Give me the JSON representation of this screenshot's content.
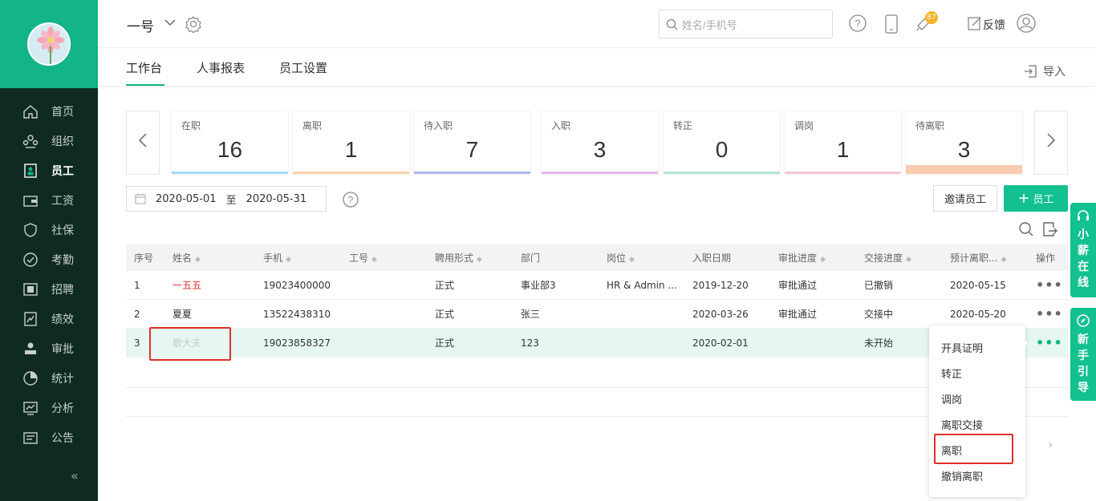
{
  "header": {
    "company": "一号",
    "search_placeholder": "姓名/手机号",
    "notification_count": "87",
    "feedback_label": "反馈"
  },
  "sidebar": {
    "items": [
      {
        "label": "首页",
        "icon": "home-icon"
      },
      {
        "label": "组织",
        "icon": "org-icon"
      },
      {
        "label": "员工",
        "icon": "employee-icon",
        "active": true
      },
      {
        "label": "工资",
        "icon": "wallet-icon"
      },
      {
        "label": "社保",
        "icon": "shield-icon"
      },
      {
        "label": "考勤",
        "icon": "attendance-icon"
      },
      {
        "label": "招聘",
        "icon": "recruit-icon"
      },
      {
        "label": "绩效",
        "icon": "performance-icon"
      },
      {
        "label": "审批",
        "icon": "approval-icon"
      },
      {
        "label": "统计",
        "icon": "pie-chart-icon"
      },
      {
        "label": "分析",
        "icon": "analysis-icon"
      },
      {
        "label": "公告",
        "icon": "announcement-icon"
      }
    ]
  },
  "tabs": [
    {
      "label": "工作台"
    },
    {
      "label": "人事报表"
    },
    {
      "label": "员工设置"
    }
  ],
  "import_label": "导入",
  "stats": [
    {
      "label": "在职",
      "value": "16",
      "color": "#9fdcf5"
    },
    {
      "label": "离职",
      "value": "1",
      "color": "#f8d2a8"
    },
    {
      "label": "待入职",
      "value": "7",
      "color": "#b2b6ee"
    },
    {
      "label": "入职",
      "value": "3",
      "color": "#e5b8f0"
    },
    {
      "label": "转正",
      "value": "0",
      "color": "#b4e6d6"
    },
    {
      "label": "调岗",
      "value": "1",
      "color": "#f6c6d8"
    },
    {
      "label": "待离职",
      "value": "3",
      "color": "#fbcbb0"
    }
  ],
  "date": {
    "start": "2020-05-01",
    "sep": "至",
    "end": "2020-05-31"
  },
  "buttons": {
    "invite": "邀请员工",
    "add": "员工"
  },
  "table": {
    "headers": [
      "序号",
      "姓名",
      "手机",
      "工号",
      "聘用形式",
      "部门",
      "岗位",
      "入职日期",
      "审批进度",
      "交接进度",
      "预计离职...",
      "操作"
    ],
    "rows": [
      {
        "no": "1",
        "name": "一五五",
        "phone": "19023400000",
        "job_no": "",
        "type": "正式",
        "dept": "事业部3",
        "post": "HR & Admin ...",
        "join": "2019-12-20",
        "approval": "审批通过",
        "handover": "已撤销",
        "leave": "2020-05-15"
      },
      {
        "no": "2",
        "name": "夏夏",
        "phone": "13522438310",
        "job_no": "",
        "type": "正式",
        "dept": "张三",
        "post": "",
        "join": "2020-03-26",
        "approval": "审批通过",
        "handover": "交接中",
        "leave": "2020-05-20"
      },
      {
        "no": "3",
        "name": "散大夫",
        "phone": "19023858327",
        "job_no": "",
        "type": "正式",
        "dept": "123",
        "post": "",
        "join": "2020-02-01",
        "approval": "",
        "handover": "未开始",
        "leave": ""
      }
    ]
  },
  "menu": [
    "开具证明",
    "转正",
    "调岗",
    "离职交接",
    "离职",
    "撤销离职"
  ],
  "float": {
    "chat": [
      "小",
      "薪",
      "在",
      "线"
    ],
    "guide": [
      "新",
      "手",
      "引",
      "导"
    ]
  },
  "colors": {
    "accent": "#13b487",
    "sidebar_bg": "#0f2a22",
    "red_highlight": "#e0302a"
  }
}
